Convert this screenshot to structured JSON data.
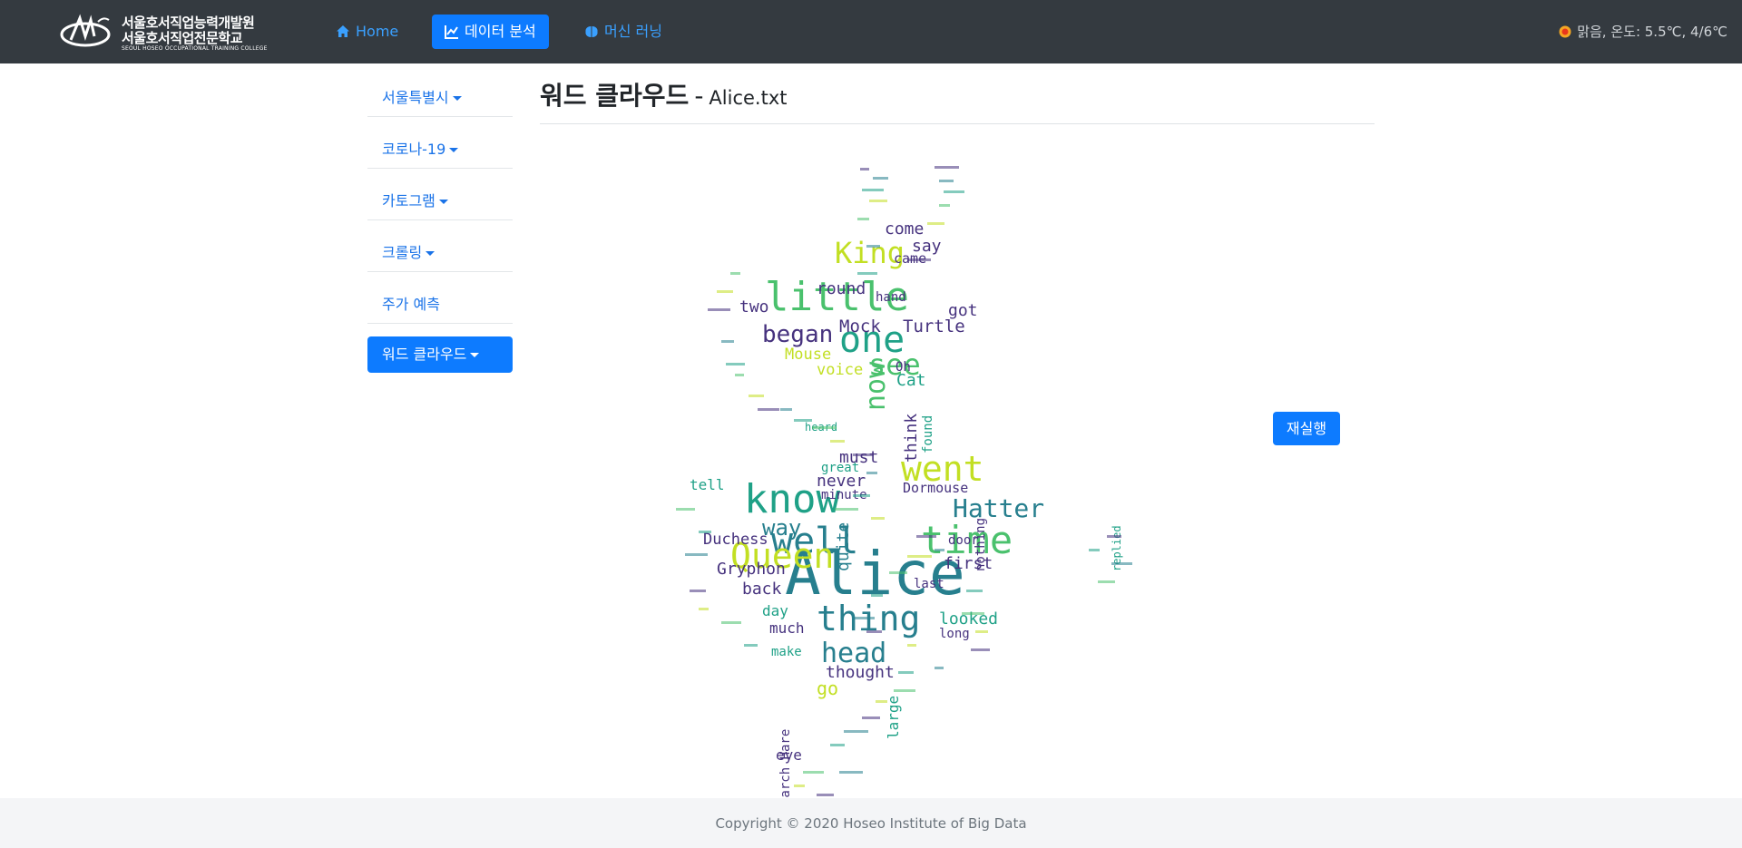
{
  "header": {
    "logo": {
      "line1": "서울호서직업능력개발원",
      "line2": "서울호서직업전문학교",
      "line3": "SEOUL HOSEO OCCUPATIONAL TRAINING COLLEGE"
    },
    "nav": [
      {
        "label": "Home",
        "icon": "home-icon",
        "active": false
      },
      {
        "label": "데이터 분석",
        "icon": "line-chart-icon",
        "active": true
      },
      {
        "label": "머신 러닝",
        "icon": "brain-icon",
        "active": false
      }
    ],
    "weather": {
      "icon": "sun-icon",
      "text": "맑음, 온도: 5.5℃, 4/6℃"
    }
  },
  "sidebar": {
    "items": [
      {
        "label": "서울특별시",
        "dropdown": true
      },
      {
        "label": "코로나-19",
        "dropdown": true
      },
      {
        "label": "카토그램",
        "dropdown": true
      },
      {
        "label": "크롤링",
        "dropdown": true
      },
      {
        "label": "주가 예측",
        "dropdown": false
      },
      {
        "label": "워드 클라우드",
        "dropdown": true,
        "active": true
      }
    ]
  },
  "main": {
    "title": "워드 클라우드",
    "separator": "-",
    "file": "Alice.txt",
    "rerun_label": "재실행",
    "wordcloud_alt": "word cloud in Alice silhouette",
    "words": [
      "Alice",
      "know",
      "well",
      "time",
      "little",
      "one",
      "see",
      "went",
      "Queen",
      "thing",
      "head",
      "King",
      "began",
      "now",
      "Hatter",
      "way",
      "Mock",
      "Turtle",
      "Mouse",
      "voice",
      "say",
      "come",
      "came",
      "round",
      "hand",
      "got",
      "two",
      "Cat",
      "must",
      "never",
      "Dormouse",
      "tell",
      "Duchess",
      "Gryphon",
      "back",
      "first",
      "looked",
      "thought",
      "go",
      "much",
      "make",
      "eye",
      "day",
      "quite",
      "nothing",
      "think",
      "found",
      "great",
      "minute",
      "long",
      "door",
      "replied",
      "large",
      "March Hare",
      "Oh",
      "last",
      "heard"
    ]
  },
  "footer": {
    "copyright": "Copyright © 2020 Hoseo Institute of Big Data"
  },
  "colors": {
    "navbar": "#343a40",
    "primary": "#0d7bff",
    "link": "#1a73e8",
    "footer": "#f4f5f7"
  }
}
